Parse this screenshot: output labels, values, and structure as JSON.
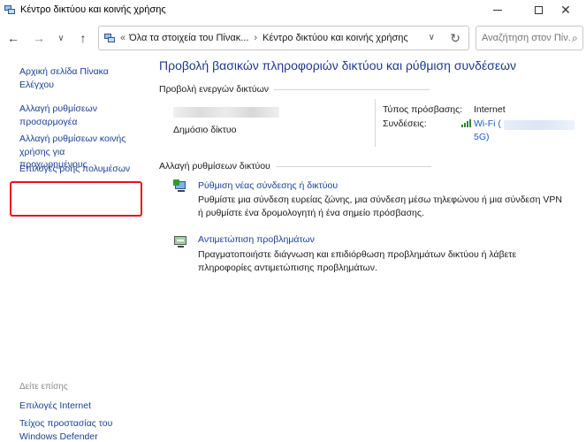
{
  "window": {
    "title": "Κέντρο δικτύου και κοινής χρήσης",
    "controls": {
      "minimize": "minimize",
      "maximize": "maximize",
      "close": "✕"
    }
  },
  "nav": {
    "back": "←",
    "forward": "→",
    "recent": "∨",
    "up": "↑"
  },
  "address": {
    "overflow": "«",
    "crumbs": [
      "Όλα τα στοιχεία του Πίνακ...",
      "Κέντρο δικτύου και κοινής χρήσης"
    ],
    "separator": "›",
    "dropdown": "∨",
    "refresh": "↻"
  },
  "search": {
    "placeholder": "Αναζήτηση στον Πίν..."
  },
  "sidebar": {
    "items": [
      {
        "label": "Αρχική σελίδα Πίνακα Ελέγχου"
      },
      {
        "label": "Αλλαγή ρυθμίσεων προσαρμογέα"
      },
      {
        "label": "Αλλαγή ρυθμίσεων κοινής χρήσης για προχωρημένους"
      },
      {
        "label": "Επιλογές ροής πολυμέσων"
      }
    ],
    "see_also_title": "Δείτε επίσης",
    "see_also": [
      {
        "label": "Επιλογές Internet"
      },
      {
        "label": "Τείχος προστασίας του Windows Defender"
      }
    ]
  },
  "main": {
    "title": "Προβολή βασικών πληροφοριών δικτύου και ρύθμιση συνδέσεων",
    "active_networks": {
      "heading": "Προβολή ενεργών δικτύων",
      "network_type": "Δημόσιο δίκτυο",
      "access_type_label": "Τύπος πρόσβασης:",
      "access_type_value": "Internet",
      "connections_label": "Συνδέσεις:",
      "connection_prefix": "Wi-Fi (",
      "connection_suffix": "5G)"
    },
    "change_settings": {
      "heading": "Αλλαγή ρυθμίσεων δικτύου",
      "tasks": [
        {
          "link": "Ρύθμιση νέας σύνδεσης ή δικτύου",
          "description": "Ρυθμίστε μια σύνδεση ευρείας ζώνης, μια σύνδεση μέσω τηλεφώνου ή μια σύνδεση VPN ή ρυθμίστε ένα δρομολογητή ή ένα σημείο πρόσβασης."
        },
        {
          "link": "Αντιμετώπιση προβλημάτων",
          "description": "Πραγματοποιήστε διάγνωση και επιδιόρθωση προβλημάτων δικτύου ή λάβετε πληροφορίες αντιμετώπισης προβλημάτων."
        }
      ]
    }
  },
  "colors": {
    "link": "#1c3f95",
    "title": "#1e3a8a",
    "highlight": "#e8111c",
    "wifi": "#2e8b2e"
  },
  "icons": [
    "network-center-icon",
    "search-icon",
    "wifi-signal-icon",
    "network-setup-icon",
    "troubleshoot-icon",
    "refresh-icon"
  ]
}
